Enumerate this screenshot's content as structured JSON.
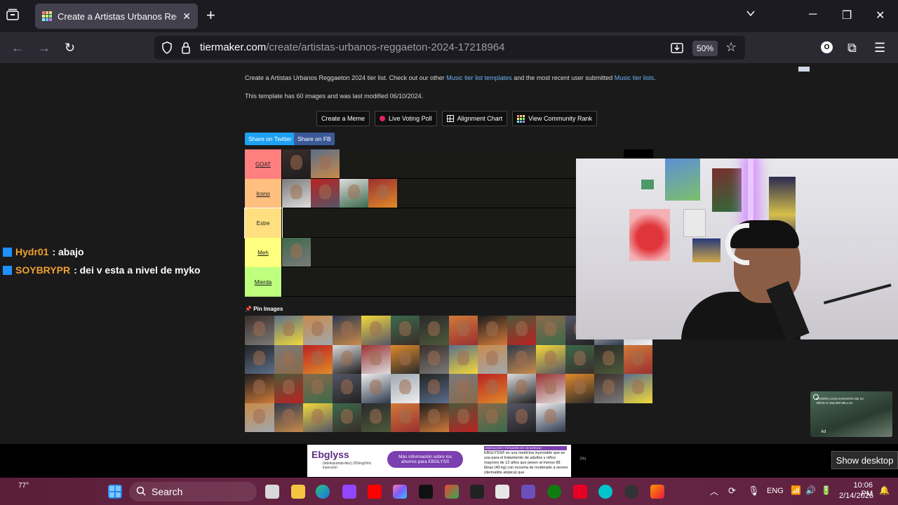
{
  "browser": {
    "tab_title": "Create a Artistas Urbanos Reggaeton 2024 Tier List - TierMaker",
    "tab_title_visible": "Create a Artistas Urbanos Regga",
    "url_domain": "tiermaker.com",
    "url_path": "/create/artistas-urbanos-reggaeton-2024-17218964",
    "zoom": "50%"
  },
  "page": {
    "description_prefix": "Create a Artistas Urbanos Reggaeton 2024 tier list. Check out our other ",
    "link1": "Music tier list templates",
    "description_mid": " and the most recent user submitted ",
    "link2": "Music tier lists",
    "description_suffix": ".",
    "template_info": "This template has 60 images and was last modified 06/10/2024.",
    "buttons": {
      "meme": "Create a Meme",
      "poll": "Live Voting Poll",
      "alignment": "Alignment Chart",
      "community": "View Community Rank"
    },
    "share_twitter": "Share on Twitter",
    "share_fb": "Share on FB",
    "tiers": [
      {
        "label": "GOAT",
        "color": "#ff7f7f",
        "count": 2
      },
      {
        "label": "Icono",
        "color": "#ffbf7f",
        "count": 4
      },
      {
        "label": "Estre",
        "color": "#ffdf7f",
        "count": 0
      },
      {
        "label": "Meh",
        "color": "#ffff7f",
        "count": 1
      },
      {
        "label": "Mierda",
        "color": "#bfff7f",
        "count": 0
      }
    ],
    "pin_images": "Pin Images",
    "pool_count": 53
  },
  "chat": [
    {
      "user": "Hydr01",
      "message": ": abajo"
    },
    {
      "user": "SOYBRYPR",
      "message": ": dei v esta a nivel de myko"
    }
  ],
  "ad": {
    "video_text": "BATERÍA CON GARANTÍA DE 10 AÑOS O 150,000 MILLAS",
    "ad_label": "Ad",
    "brand": "Ebglyss",
    "brand_sub": "(lebrikizumab-lbkz) 250mg/2mL inyección",
    "cta": "Más información sobre los ahorros para EBGLYSS",
    "safety_title": "INDICACIÓN Y RESUMEN DE SEGURIDAD",
    "safety_text": "EBGLYSS® es una medicina inyectable que se usa para el tratamiento de adultos y niños mayores de 12 años que pesen al menos 88 libras (40 kg) con eccema de moderado a severo (dermatitis atópica) que",
    "pn": "PN"
  },
  "show_desktop": "Show desktop",
  "taskbar": {
    "weather": "77°",
    "search": "Search",
    "lang": "ENG",
    "time": "10:06 PM",
    "date": "2/14/2026"
  },
  "colors": {
    "accent_twitter": "#1da1f2",
    "accent_fb": "#3b5998",
    "link": "#6ab0f3"
  }
}
